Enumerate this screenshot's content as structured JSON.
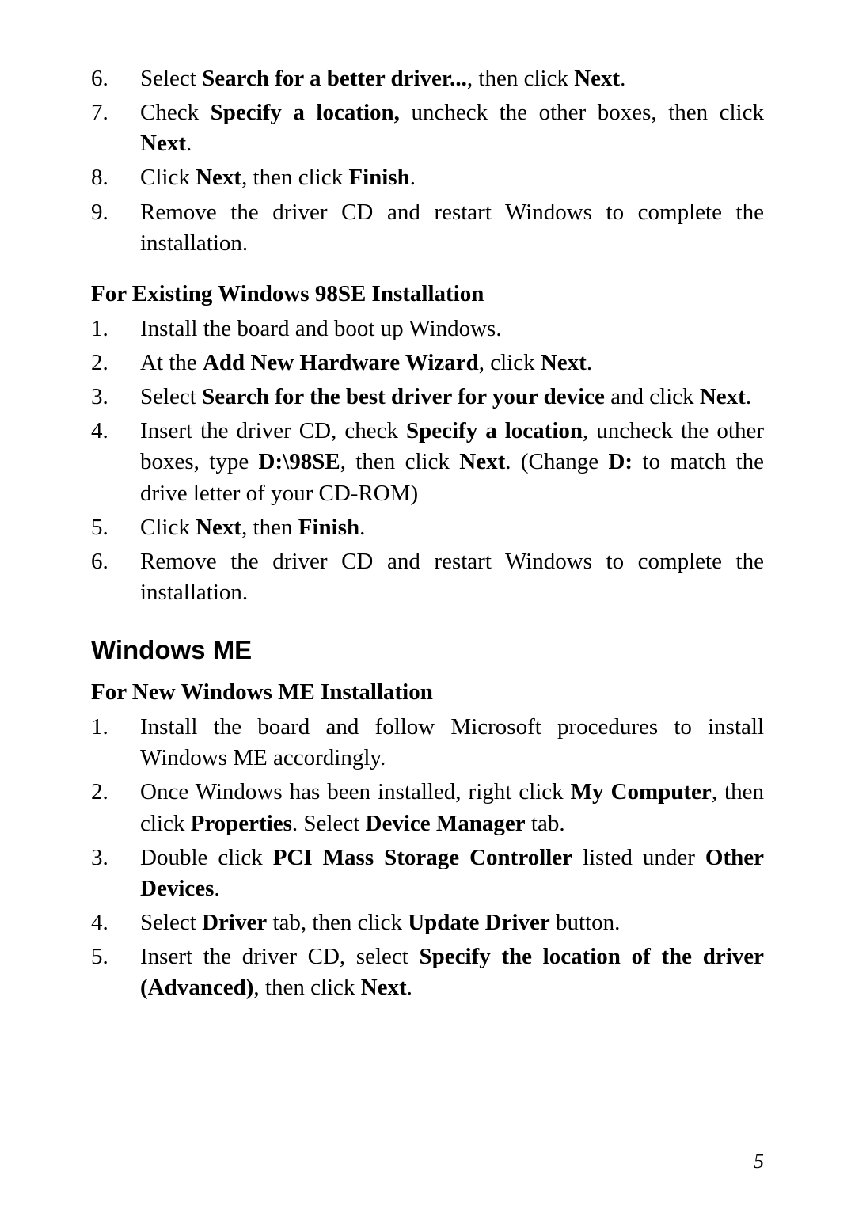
{
  "section1": {
    "items": [
      {
        "num": "6.",
        "segments": [
          "Select ",
          {
            "b": "Search for a better driver..."
          },
          ", then click ",
          {
            "b": "Next"
          },
          "."
        ]
      },
      {
        "num": "7.",
        "segments": [
          "Check ",
          {
            "b": "Specify a location,"
          },
          " uncheck the other boxes, then click ",
          {
            "b": "Next"
          },
          "."
        ]
      },
      {
        "num": "8.",
        "segments": [
          "Click ",
          {
            "b": "Next"
          },
          ", then click ",
          {
            "b": "Finish"
          },
          "."
        ]
      },
      {
        "num": "9.",
        "segments": [
          "Remove the driver CD and restart Windows to complete the installation."
        ]
      }
    ]
  },
  "heading1": "For Existing Windows 98SE Installation",
  "section2": {
    "items": [
      {
        "num": "1.",
        "segments": [
          "Install the board and boot up Windows."
        ]
      },
      {
        "num": "2.",
        "segments": [
          "At the ",
          {
            "b": "Add New Hardware Wizard"
          },
          ", click ",
          {
            "b": "Next"
          },
          "."
        ]
      },
      {
        "num": "3.",
        "segments": [
          "Select ",
          {
            "b": "Search for the best driver for your device"
          },
          " and click ",
          {
            "b": "Next"
          },
          "."
        ]
      },
      {
        "num": "4.",
        "segments": [
          "Insert the driver CD, check ",
          {
            "b": "Specify a location"
          },
          ", uncheck the other boxes, type ",
          {
            "b": "D:\\98SE"
          },
          ", then click ",
          {
            "b": "Next"
          },
          ".  (Change ",
          {
            "b": "D:"
          },
          " to match the drive letter of your CD-ROM)"
        ]
      },
      {
        "num": "5.",
        "segments": [
          "Click ",
          {
            "b": "Next"
          },
          ", then ",
          {
            "b": "Finish"
          },
          "."
        ]
      },
      {
        "num": "6.",
        "segments": [
          "Remove the driver CD and restart Windows to complete the installation."
        ]
      }
    ]
  },
  "heading2": "Windows ME",
  "heading3": "For New Windows ME Installation",
  "section3": {
    "items": [
      {
        "num": "1.",
        "segments": [
          "Install the board and follow Microsoft procedures to install Windows ME accordingly."
        ]
      },
      {
        "num": "2.",
        "segments": [
          "Once Windows has been installed, right click ",
          {
            "b": "My Computer"
          },
          ", then click ",
          {
            "b": "Properties"
          },
          ".  Select ",
          {
            "b": "Device Manager"
          },
          " tab."
        ]
      },
      {
        "num": "3.",
        "segments": [
          "Double click ",
          {
            "b": "PCI Mass Storage Controller"
          },
          " listed under ",
          {
            "b": "Other Devices"
          },
          "."
        ]
      },
      {
        "num": "4.",
        "segments": [
          "Select ",
          {
            "b": "Driver"
          },
          " tab, then click ",
          {
            "b": "Update Driver"
          },
          " button."
        ]
      },
      {
        "num": "5.",
        "segments": [
          "Insert the driver CD, select ",
          {
            "b": "Specify the location of the driver (Advanced)"
          },
          ", then click ",
          {
            "b": "Next"
          },
          "."
        ]
      }
    ]
  },
  "pageNumber": "5"
}
